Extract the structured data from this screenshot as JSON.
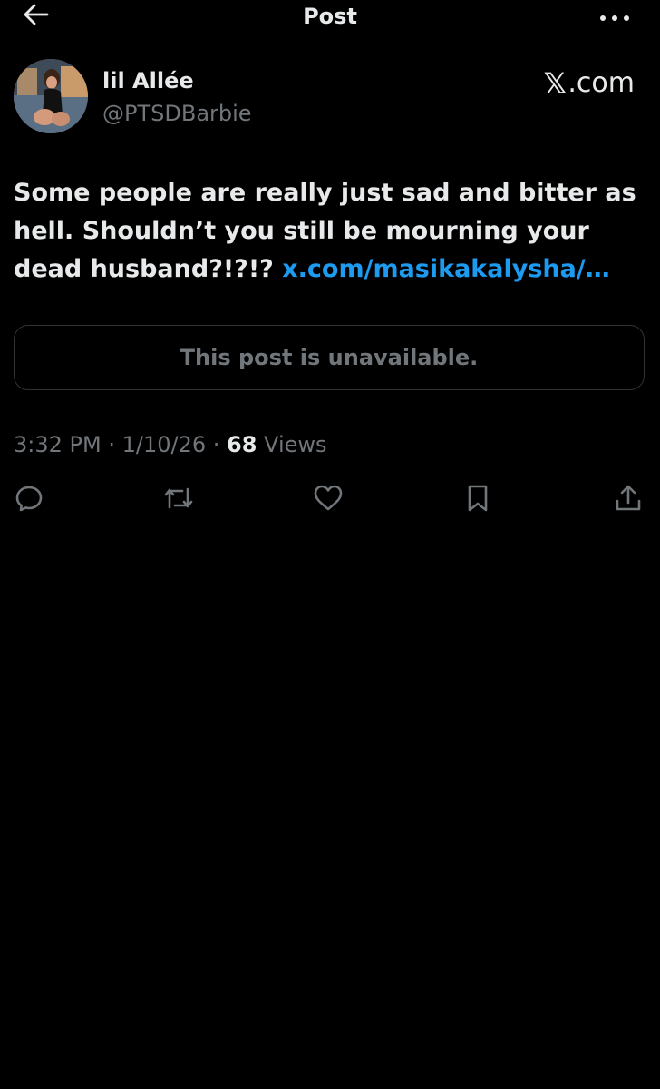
{
  "header": {
    "title": "Post",
    "back_icon": "arrow-left-icon",
    "more_icon": "more-horizontal-icon"
  },
  "author": {
    "display_name": "lil Allée",
    "handle": "@PTSDBarbie"
  },
  "source": {
    "glyph": "𝕏",
    "label": ".com"
  },
  "post": {
    "line1": "Some people are really just sad and bitter as",
    "line2": "hell. Shouldn’t you still be mourning your",
    "line3_text": "dead husband?!?!? ",
    "link": "x.com/masikakalysha/…"
  },
  "quote": {
    "message": "This post is unavailable."
  },
  "meta": {
    "time": "3:32 PM",
    "sep1": " · ",
    "date": "1/10/26",
    "sep2": " · ",
    "views_count": "68",
    "views_label": " Views"
  },
  "actions": {
    "reply_icon": "reply-icon",
    "repost_icon": "repost-icon",
    "like_icon": "heart-icon",
    "bookmark_icon": "bookmark-icon",
    "share_icon": "share-icon"
  },
  "colors": {
    "background": "#000000",
    "text_primary": "#e7e9ea",
    "text_secondary": "#71767b",
    "link": "#1d9bf0",
    "border": "#2f3336"
  }
}
